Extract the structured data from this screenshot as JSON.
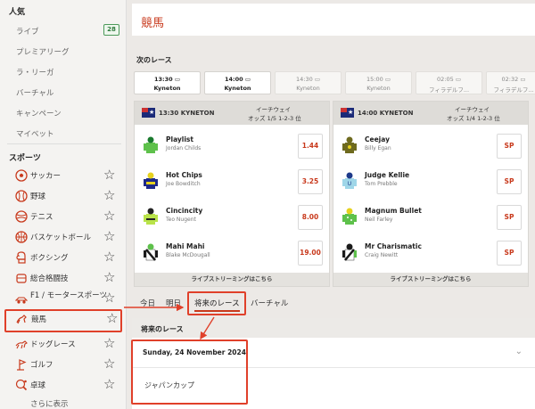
{
  "sidebar": {
    "popular_heading": "人気",
    "popular_items": [
      "ライブ",
      "プレミアリーグ",
      "ラ・リーガ",
      "バーチャル",
      "キャンペーン",
      "マイベット"
    ],
    "live_count": "28",
    "sports_heading": "スポーツ",
    "sports": [
      {
        "label": "サッカー",
        "icon": "soccer-icon"
      },
      {
        "label": "野球",
        "icon": "baseball-icon"
      },
      {
        "label": "テニス",
        "icon": "tennis-icon"
      },
      {
        "label": "バスケットボール",
        "icon": "basketball-icon"
      },
      {
        "label": "ボクシング",
        "icon": "boxing-icon"
      },
      {
        "label": "総合格闘技",
        "icon": "mma-icon"
      },
      {
        "label": "F1 / モータースポーツ",
        "icon": "f1-icon"
      },
      {
        "label": "競馬",
        "icon": "horse-racing-icon",
        "active": true
      },
      {
        "label": "ドッグレース",
        "icon": "greyhound-icon"
      },
      {
        "label": "ゴルフ",
        "icon": "golf-icon"
      },
      {
        "label": "卓球",
        "icon": "table-tennis-icon"
      }
    ],
    "more_label": "さらに表示"
  },
  "page": {
    "title": "競馬"
  },
  "next_races": {
    "heading": "次のレース",
    "tabs": [
      {
        "time": "13:30",
        "track": "Kyneton",
        "selected": true
      },
      {
        "time": "14:00",
        "track": "Kyneton",
        "selected": true
      },
      {
        "time": "14:30",
        "track": "Kyneton",
        "selected": false
      },
      {
        "time": "15:00",
        "track": "Kyneton",
        "selected": false
      },
      {
        "time": "02:05",
        "track": "フィラデルフ...",
        "selected": false
      },
      {
        "time": "02:32",
        "track": "フィラデルフ...",
        "selected": false
      }
    ]
  },
  "race_cards": [
    {
      "race": "13:30 KYNETON",
      "meta1": "イーチウェイ",
      "meta2": "オッズ 1/5 1-2-3 位",
      "runners": [
        {
          "name": "Playlist",
          "jockey": "Jordan Childs",
          "odds": "1.44"
        },
        {
          "name": "Hot Chips",
          "jockey": "Joe Bowditch",
          "odds": "3.25"
        },
        {
          "name": "Cincincity",
          "jockey": "Teo Nugent",
          "odds": "8.00"
        },
        {
          "name": "Mahi Mahi",
          "jockey": "Blake McDougall",
          "odds": "19.00"
        }
      ],
      "footer": "ライブストリーミングはこちら"
    },
    {
      "race": "14:00 KYNETON",
      "meta1": "イーチウェイ",
      "meta2": "オッズ 1/4 1-2-3 位",
      "runners": [
        {
          "name": "Ceejay",
          "jockey": "Billy Egan",
          "odds": "SP"
        },
        {
          "name": "Judge Kellie",
          "jockey": "Tom Prebble",
          "odds": "SP"
        },
        {
          "name": "Magnum Bullet",
          "jockey": "Neil Farley",
          "odds": "SP"
        },
        {
          "name": "Mr Charismatic",
          "jockey": "Craig Newitt",
          "odds": "SP"
        }
      ],
      "footer": "ライブストリーミングはこちら"
    }
  ],
  "day_tabs": [
    "今日",
    "明日",
    "将来のレース",
    "バーチャル"
  ],
  "future": {
    "heading": "将来のレース",
    "date": "Sunday, 24 November 2024",
    "race": "ジャパンカップ"
  },
  "colors": {
    "accent": "#c8391c",
    "highlight": "#e0402a",
    "live_badge": "#2f7a3d"
  }
}
